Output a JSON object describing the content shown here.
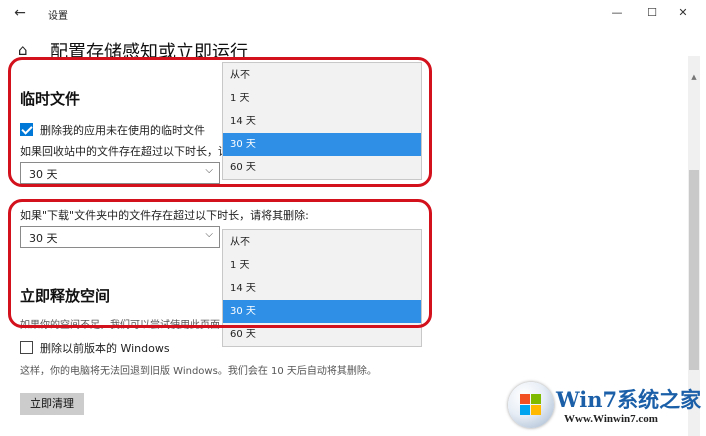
{
  "window": {
    "title": "设置",
    "minimize": "—",
    "maximize": "☐",
    "close": "✕"
  },
  "page": {
    "title": "配置存储感知或立即运行"
  },
  "temp_files": {
    "heading": "临时文件",
    "delete_unused_label": "删除我的应用未在使用的临时文件",
    "delete_unused_checked": true,
    "recycle_prompt": "如果回收站中的文件存在超过以下时长，请",
    "recycle_value": "30 天"
  },
  "downloads": {
    "prompt": "如果\"下载\"文件夹中的文件存在超过以下时长，请将其删除:",
    "value": "30 天"
  },
  "dropdown_recycle": {
    "options": [
      "从不",
      "1 天",
      "14 天",
      "30 天",
      "60 天"
    ],
    "selected_index": 3
  },
  "dropdown_downloads": {
    "options": [
      "从不",
      "1 天",
      "14 天",
      "30 天",
      "60 天"
    ],
    "selected_index": 3
  },
  "free_space": {
    "heading": "立即释放空间",
    "description": "如果你的空间不足，我们可以尝试使用此页面",
    "delete_previous_label": "删除以前版本的 Windows",
    "delete_previous_checked": false,
    "note": "这样，你的电脑将无法回退到旧版 Windows。我们会在 10 天后自动将其删除。",
    "clean_button": "立即清理"
  },
  "watermark": {
    "logo_text": "Win7系统之家",
    "url": "Www.Winwin7.com"
  },
  "colors": {
    "accent": "#0078d7",
    "selected_item": "#2f8fe6",
    "highlight": "#d3111d"
  }
}
